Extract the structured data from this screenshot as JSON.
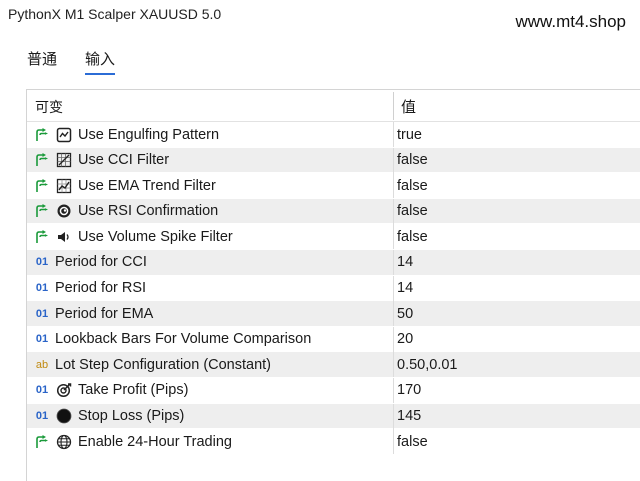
{
  "window": {
    "title": "PythonX M1 Scalper XAUUSD 5.0",
    "watermark": "www.mt4.shop"
  },
  "tabs": [
    {
      "label": "普通"
    },
    {
      "label": "输入",
      "active": true
    }
  ],
  "table": {
    "col_variable": "可变",
    "col_value": "值",
    "rows": [
      {
        "type": "bool",
        "icon": "engulfing-pattern-icon",
        "name": "Use Engulfing Pattern",
        "value": "true"
      },
      {
        "type": "bool",
        "icon": "cci-filter-icon",
        "name": "Use CCI Filter",
        "value": "false"
      },
      {
        "type": "bool",
        "icon": "ema-trend-icon",
        "name": "Use EMA Trend Filter",
        "value": "false"
      },
      {
        "type": "bool",
        "icon": "rsi-spiral-icon",
        "name": "Use RSI Confirmation",
        "value": "false"
      },
      {
        "type": "bool",
        "icon": "volume-speaker-icon",
        "name": "Use Volume Spike Filter",
        "value": "false"
      },
      {
        "type": "int",
        "icon": "",
        "name": "Period for CCI",
        "value": "14"
      },
      {
        "type": "int",
        "icon": "",
        "name": "Period for RSI",
        "value": "14"
      },
      {
        "type": "int",
        "icon": "",
        "name": "Period for EMA",
        "value": "50"
      },
      {
        "type": "int",
        "icon": "",
        "name": "Lookback Bars For Volume Comparison",
        "value": "20"
      },
      {
        "type": "string",
        "icon": "",
        "name": "Lot Step Configuration (Constant)",
        "value": "0.50,0.01"
      },
      {
        "type": "int",
        "icon": "target-icon",
        "name": "Take Profit (Pips)",
        "value": "170"
      },
      {
        "type": "int",
        "icon": "stop-circle-icon",
        "name": "Stop Loss (Pips)",
        "value": "145"
      },
      {
        "type": "bool",
        "icon": "globe-icon",
        "name": "Enable 24-Hour Trading",
        "value": "false"
      }
    ]
  },
  "type_glyphs": {
    "int": "01",
    "string": "ab"
  },
  "colors": {
    "accent": "#2b6cd6",
    "bool_icon": "#1a9a3a",
    "int_icon": "#2a64c8",
    "string_icon": "#c08a10",
    "alt_row": "#eeeeee"
  }
}
